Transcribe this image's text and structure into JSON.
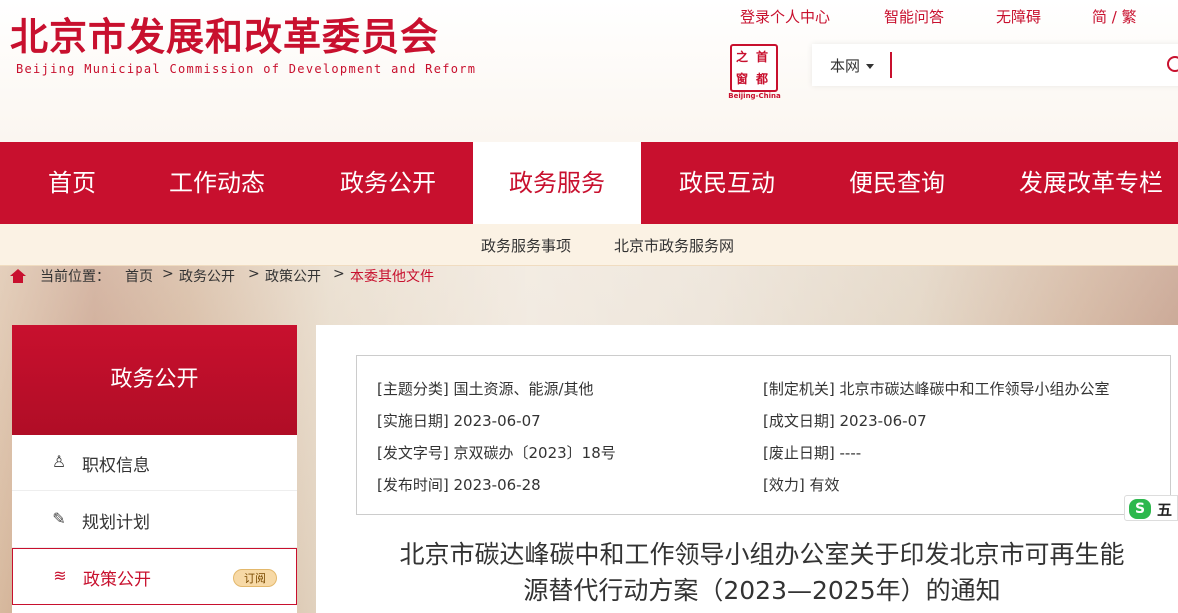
{
  "header": {
    "title": "北京市发展和改革委员会",
    "subtitle": "Beijing Municipal Commission of Development and Reform",
    "top_links": [
      "登录个人中心",
      "智能问答",
      "无障碍",
      "简 / 繁"
    ],
    "seal_chars": [
      "首",
      "都",
      "之",
      "窗"
    ],
    "seal_caption": "Beijing-China",
    "search_scope": "本网",
    "search_value": "",
    "search_placeholder": ""
  },
  "nav": {
    "items": [
      "首页",
      "工作动态",
      "政务公开",
      "政务服务",
      "政民互动",
      "便民查询",
      "发展改革专栏"
    ],
    "active_index": 3
  },
  "subnav": {
    "items": [
      "政务服务事项",
      "北京市政务服务网"
    ]
  },
  "breadcrumb": {
    "prefix": "当前位置：",
    "items": [
      "首页",
      "政务公开",
      "政策公开",
      "本委其他文件"
    ],
    "separator": ">"
  },
  "sidebar": {
    "title": "政务公开",
    "items": [
      {
        "label": "职权信息",
        "icon": "person-icon"
      },
      {
        "label": "规划计划",
        "icon": "edit-doc-icon"
      },
      {
        "label": "政策公开",
        "icon": "layers-icon",
        "badge": "订阅"
      }
    ]
  },
  "meta": {
    "rows": [
      {
        "label": "[主题分类]",
        "value": "国土资源、能源/其他"
      },
      {
        "label": "[制定机关]",
        "value": "北京市碳达峰碳中和工作领导小组办公室"
      },
      {
        "label": "[实施日期]",
        "value": "2023-06-07"
      },
      {
        "label": "[成文日期]",
        "value": "2023-06-07"
      },
      {
        "label": "[发文字号]",
        "value": "京双碳办〔2023〕18号"
      },
      {
        "label": "[废止日期]",
        "value": "----"
      },
      {
        "label": "[发布时间]",
        "value": "2023-06-28"
      },
      {
        "label": "[效力]",
        "value": "有效"
      }
    ]
  },
  "document": {
    "title_line1": "北京市碳达峰碳中和工作领导小组办公室关于印发北京市可再生能",
    "title_line2": "源替代行动方案（2023—2025年）的通知"
  },
  "ime": {
    "logo": "S",
    "mode": "五"
  },
  "colors": {
    "brand_red": "#c8102e",
    "subnav_bg": "#fbf2e4",
    "badge_bg": "#f7d9a6"
  }
}
